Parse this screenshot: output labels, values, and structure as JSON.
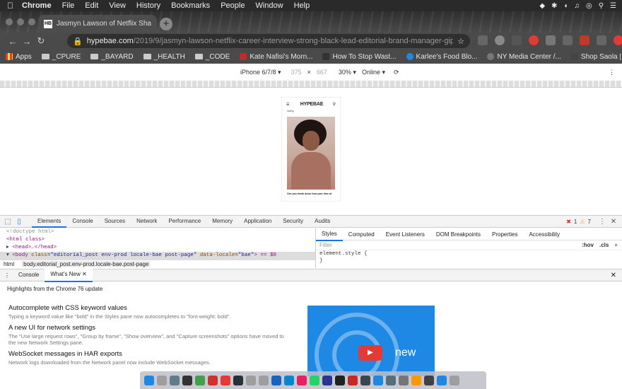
{
  "menubar": {
    "app": "Chrome",
    "items": [
      "File",
      "Edit",
      "View",
      "History",
      "Bookmarks",
      "People",
      "Window",
      "Help"
    ],
    "status_icons": [
      "dropbox-icon",
      "bluetooth-icon",
      "wifi-icon",
      "volume-icon",
      "siri-icon",
      "search-icon",
      "menu-icon"
    ]
  },
  "tab": {
    "title": "Jasmyn Lawson of Netflix Sha",
    "favicon": "HB"
  },
  "address": {
    "host": "hypebae.com",
    "path": "/2019/9/jasmyn-lawson-netflix-career-interview-strong-black-lead-editorial-brand-manager-giphy"
  },
  "bookmarks": [
    {
      "label": "Apps",
      "type": "apps"
    },
    {
      "label": "_CPURE",
      "type": "folder"
    },
    {
      "label": "_BAYARD",
      "type": "folder"
    },
    {
      "label": "_HEALTH",
      "type": "folder"
    },
    {
      "label": "_CODE",
      "type": "folder"
    },
    {
      "label": "Kate Nafisi's Morn...",
      "type": "link",
      "color": "#c62828"
    },
    {
      "label": "How To Stop Wast...",
      "type": "link",
      "color": "#333333"
    },
    {
      "label": "Karlee's Food Blo...",
      "type": "link",
      "color": "#1e88e5"
    },
    {
      "label": "NY Media Center /...",
      "type": "link",
      "color": "#555555"
    },
    {
      "label": "Shop Saola | Huck...",
      "type": "link",
      "color": "#444444"
    }
  ],
  "device_toolbar": {
    "device": "iPhone 6/7/8",
    "width": "375",
    "height": "667",
    "zoom": "30%",
    "network": "Online"
  },
  "phone_page": {
    "logo": "HYPEBAE",
    "category": "dating",
    "caption": "Can you break down how your time at"
  },
  "devtools": {
    "tabs": [
      "Elements",
      "Console",
      "Sources",
      "Network",
      "Performance",
      "Memory",
      "Application",
      "Security",
      "Audits"
    ],
    "active_tab": "Elements",
    "error_count": "1",
    "warning_count": "7",
    "dom": {
      "doctype": "<!doctype html>",
      "html_open": "<html class>",
      "head": "<head>…</head>",
      "body_tag": "<body",
      "body_attr1": "class",
      "body_val1": "\"editorial_post env-prod locale-bae post-page\"",
      "body_attr2": "data-locale",
      "body_val2": "\"bae\"",
      "body_end": "> == $0"
    },
    "breadcrumbs": [
      "html",
      "body.editorial_post.env-prod.locale-bae.post-page"
    ],
    "styles_tabs": [
      "Styles",
      "Computed",
      "Event Listeners",
      "DOM Breakpoints",
      "Properties",
      "Accessibility"
    ],
    "filter_placeholder": "Filter",
    "filter_hov": ":hov",
    "filter_cls": ".cls",
    "element_style": "element.style {",
    "element_style_close": "}"
  },
  "drawer": {
    "tabs": [
      "Console",
      "What's New"
    ],
    "active_tab": "What's New",
    "highlights": "Highlights from the Chrome 76 update",
    "items": [
      {
        "title": "Autocomplete with CSS keyword values",
        "desc": "Typing a keyword value like \"bold\" in the Styles pane now autocompletes to \"font-weight: bold\"."
      },
      {
        "title": "A new UI for network settings",
        "desc": "The \"Use large request rows\", \"Group by frame\", \"Show overview\", and \"Capture screenshots\" options have moved to the new Network Settings pane."
      },
      {
        "title": "WebSocket messages in HAR exports",
        "desc": "Network logs downloaded from the Network panel now include WebSocket messages."
      }
    ],
    "promo_text": "new"
  },
  "dock_colors": [
    "#1e88e5",
    "#9e9e9e",
    "#607d8b",
    "#333333",
    "#43a047",
    "#d32f2f",
    "#e53935",
    "#263238",
    "#9e9e9e",
    "#9e9e9e",
    "#1565c0",
    "#0288d1",
    "#e91e63",
    "#25d366",
    "#283593",
    "#212121",
    "#c62828",
    "#37474f",
    "#1e88e5",
    "#546e7a",
    "#757575",
    "#ff9800",
    "#424242",
    "#1e88e5",
    "#9e9e9e"
  ]
}
